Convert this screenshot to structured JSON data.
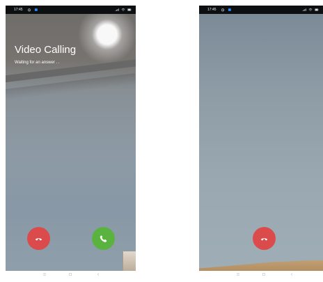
{
  "screens": [
    {
      "status_bar": {
        "time": "17:45"
      },
      "call": {
        "title": "Video Calling",
        "subtitle": "Waiting for an answer . ."
      }
    },
    {
      "status_bar": {
        "time": "17:45"
      }
    }
  ],
  "colors": {
    "end_call": "#dc4b4b",
    "accept_call": "#5bb33f",
    "status_bar": "#0d0f11"
  },
  "icons": {
    "status_left": [
      "alarm-icon",
      "notification-icon"
    ],
    "status_right": [
      "signal-icon",
      "wifi-icon",
      "battery-icon"
    ],
    "navigation": [
      "menu-icon",
      "home-icon",
      "back-icon"
    ],
    "call_left": [
      "end-call-icon",
      "accept-call-icon"
    ],
    "call_right": [
      "end-call-icon"
    ]
  }
}
